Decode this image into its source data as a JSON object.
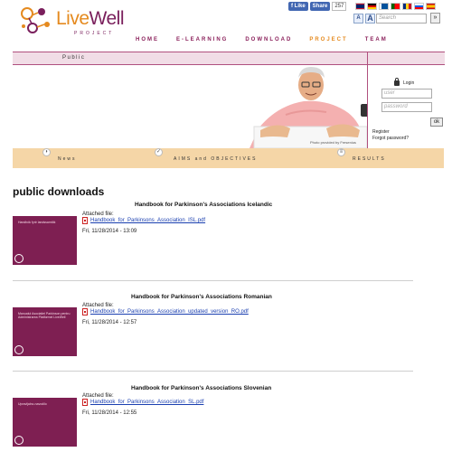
{
  "logo": {
    "text_live": "Live",
    "text_well": "Well",
    "subtitle": "PROJECT"
  },
  "social": {
    "like": "f Like",
    "share": "Share",
    "count": "257"
  },
  "font_controls": {
    "small": "A",
    "large": "A"
  },
  "search": {
    "placeholder": "Search",
    "go": "»"
  },
  "nav": [
    "HOME",
    "E-LEARNING",
    "DOWNLOAD",
    "PROJECT",
    "TEAM"
  ],
  "banner": {
    "section_label": "Public",
    "photo_credit": "Photo provided by Fresenius"
  },
  "login": {
    "title": "Login",
    "user_placeholder": "user",
    "password_placeholder": "password",
    "ok": "ok",
    "register": "Register",
    "forgot": "Forgot password?"
  },
  "infobar": {
    "news": "News",
    "aims": "AIMS and OBJECTIVES",
    "results": "RESULTS"
  },
  "page_title": "public downloads",
  "downloads": [
    {
      "title": "Handbook for Parkinson's Associations Icelandic",
      "thumb_text": "Handbók fyrir landssamtök",
      "attached_label": "Attached file:",
      "file": "Handbook_for_Parkinsons_Association_ISL.pdf",
      "date": "Fri, 11/28/2014 - 13:09"
    },
    {
      "title": "Handbook for Parkinson's Associations Romanian",
      "thumb_text": "Manualul Asociatiei Parkinson pentru Administrarea Platformei LiveWell",
      "attached_label": "Attached file:",
      "file": "Handbook_for_Parkinsons_Association_updated_version_RO.pdf",
      "date": "Fri, 11/28/2014 - 12:57"
    },
    {
      "title": "Handbook for Parkinson's Associations Slovenian",
      "thumb_text": "Upravljalno-navodilo",
      "attached_label": "Attached file:",
      "file": "Handbook_for_Parkinsons_Association_SL.pdf",
      "date": "Fri, 11/28/2014 - 12:55"
    }
  ],
  "colors": {
    "brand": "#7a1f5c",
    "accent": "#e58a1f",
    "banner_bar": "#f1dde6",
    "infobar": "#f5d6a7"
  }
}
